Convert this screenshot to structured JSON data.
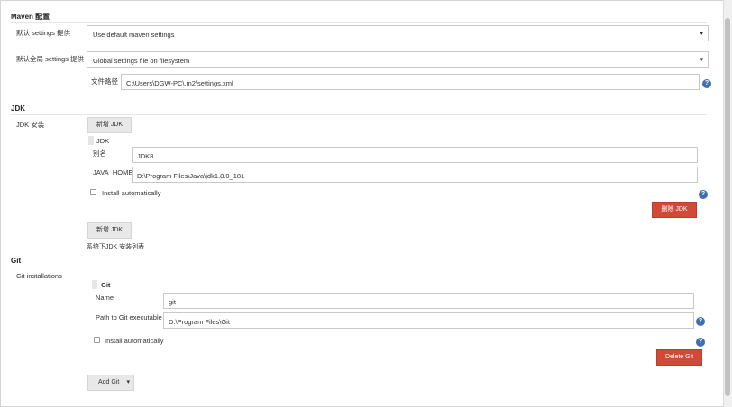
{
  "maven": {
    "title": "Maven 配置",
    "default_settings_label": "默认 settings 提供",
    "default_settings_value": "Use default maven settings",
    "global_settings_label": "默认全局 settings 提供",
    "global_settings_value": "Global settings file on filesystem",
    "file_path_label": "文件路径",
    "file_path_value": "C:\\Users\\DGW-PC\\.m2\\settings.xml"
  },
  "jdk": {
    "title": "JDK",
    "install_label": "JDK 安装",
    "add_jdk_top": "新增 JDK",
    "item_header": "JDK",
    "alias_label": "别名",
    "alias_value": "JDK8",
    "java_home_label": "JAVA_HOME",
    "java_home_value": "D:\\Program Files\\Java\\jdk1.8.0_181",
    "install_auto": "Install automatically",
    "delete_jdk": "删除 JDK",
    "add_jdk_bottom": "新增 JDK",
    "system_list": "系统下JDK 安装列表"
  },
  "git": {
    "title": "Git",
    "installations_label": "Git installations",
    "item_header": "Git",
    "name_label": "Name",
    "name_value": "git",
    "path_label": "Path to Git executable",
    "path_value": "D:\\Program Files\\Git",
    "install_auto": "Install automatically",
    "delete_git": "Delete Git",
    "add_git": "Add Git"
  },
  "icons": {
    "help": "?",
    "caret": "▾"
  }
}
